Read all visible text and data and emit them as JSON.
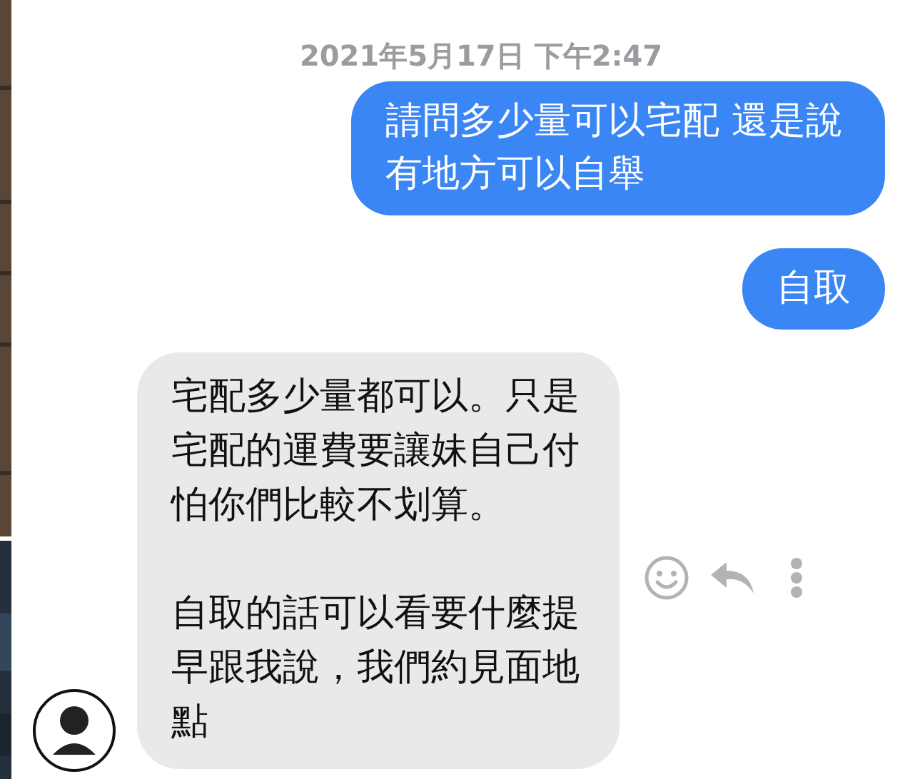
{
  "timestamp": "2021年5月17日 下午2:47",
  "messages": [
    {
      "kind": "sent",
      "text": "請問多少量可以宅配 還是說有地方可以自舉"
    },
    {
      "kind": "sent",
      "text": "自取"
    },
    {
      "kind": "received",
      "paragraphs": [
        "宅配多少量都可以。只是宅配的運費要讓妹自己付怕你們比較不划算。",
        "自取的話可以看要什麼提早跟我說，我們約見面地點"
      ]
    }
  ]
}
